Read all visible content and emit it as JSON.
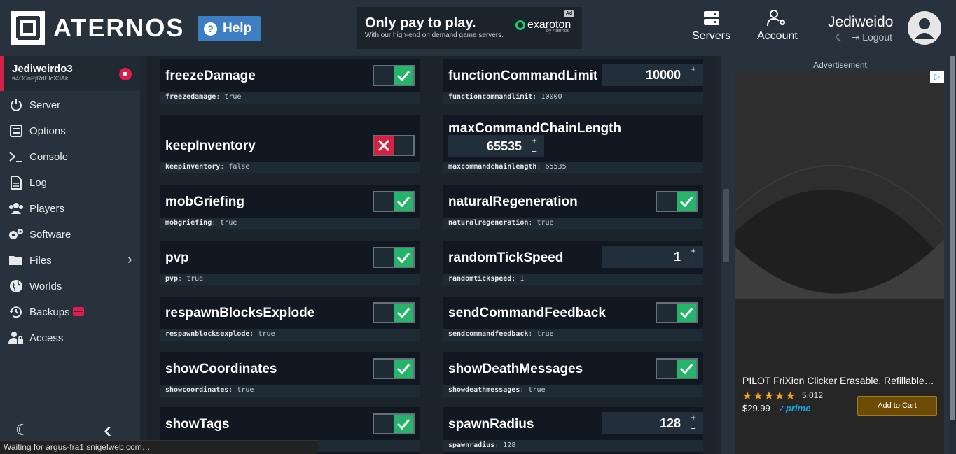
{
  "header": {
    "logo_text": "ATERNOS",
    "help_label": "Help",
    "ad": {
      "headline": "Only pay to play.",
      "subline": "With our high-end on demand game servers.",
      "brand": "exaroton",
      "brand_by": "by Aternos",
      "tag": "Ad"
    },
    "nav": {
      "servers": "Servers",
      "account": "Account"
    },
    "user": {
      "name": "Jediweido",
      "logout": "Logout"
    }
  },
  "sidebar": {
    "server_name": "Jediweirdo3",
    "server_id": "#4O5nPjRrlElcX3Ak",
    "items": [
      {
        "label": "Server",
        "icon": "power-icon"
      },
      {
        "label": "Options",
        "icon": "sliders-icon"
      },
      {
        "label": "Console",
        "icon": "terminal-icon"
      },
      {
        "label": "Log",
        "icon": "file-icon"
      },
      {
        "label": "Players",
        "icon": "users-icon"
      },
      {
        "label": "Software",
        "icon": "gears-icon"
      },
      {
        "label": "Files",
        "icon": "folder-icon"
      },
      {
        "label": "Worlds",
        "icon": "globe-icon"
      },
      {
        "label": "Backups",
        "icon": "backup-icon"
      },
      {
        "label": "Access",
        "icon": "user-lock-icon"
      }
    ]
  },
  "options": [
    {
      "title": "freezeDamage",
      "key": "freezedamage",
      "value": "true",
      "type": "toggle"
    },
    {
      "title": "functionCommandLimit",
      "key": "functioncommandlimit",
      "value": "10000",
      "type": "number"
    },
    {
      "title": "keepInventory",
      "key": "keepinventory",
      "value": "false",
      "type": "toggle"
    },
    {
      "title": "maxCommandChainLength",
      "key": "maxcommandchainlength",
      "value": "65535",
      "type": "number"
    },
    {
      "title": "mobGriefing",
      "key": "mobgriefing",
      "value": "true",
      "type": "toggle"
    },
    {
      "title": "naturalRegeneration",
      "key": "naturalregeneration",
      "value": "true",
      "type": "toggle"
    },
    {
      "title": "pvp",
      "key": "pvp",
      "value": "true",
      "type": "toggle"
    },
    {
      "title": "randomTickSpeed",
      "key": "randomtickspeed",
      "value": "1",
      "type": "number"
    },
    {
      "title": "respawnBlocksExplode",
      "key": "respawnblocksexplode",
      "value": "true",
      "type": "toggle"
    },
    {
      "title": "sendCommandFeedback",
      "key": "sendcommandfeedback",
      "value": "true",
      "type": "toggle"
    },
    {
      "title": "showCoordinates",
      "key": "showcoordinates",
      "value": "true",
      "type": "toggle"
    },
    {
      "title": "showDeathMessages",
      "key": "showdeathmessages",
      "value": "true",
      "type": "toggle"
    },
    {
      "title": "showTags",
      "key": "showtags",
      "value": "true",
      "type": "toggle"
    },
    {
      "title": "spawnRadius",
      "key": "spawnradius",
      "value": "128",
      "type": "number"
    }
  ],
  "stepper": {
    "plus": "+",
    "minus": "−"
  },
  "ad_panel": {
    "label": "Advertisement",
    "product": "PILOT FriXion Clicker Erasable, Refillable…",
    "stars": "★★★★★",
    "rating_count": "5,012",
    "price": "$29.99",
    "prime": "✓prime",
    "cart_label": "Add to Cart"
  },
  "status_text": "Waiting for argus-fra1.snigelweb.com…",
  "colors": {
    "accent_green": "#26b36a",
    "accent_red": "#d5203f",
    "help_blue": "#3b7ec4",
    "stop_red": "#e31a4e"
  }
}
